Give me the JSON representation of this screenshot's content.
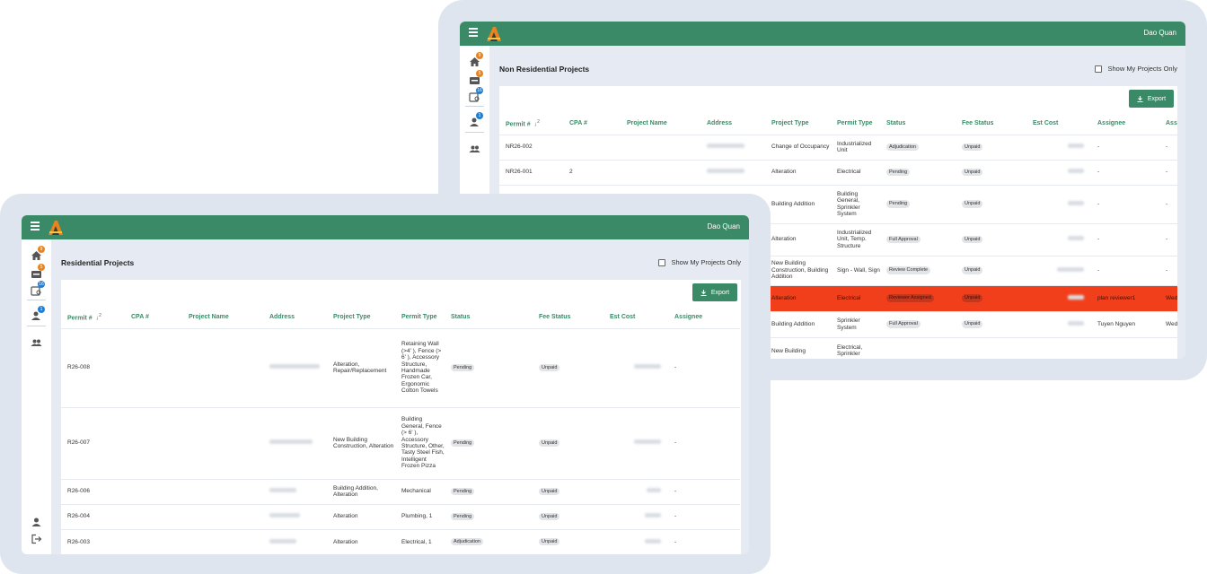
{
  "back": {
    "user": "Dao Quan",
    "rail_badges": [
      "9",
      "5",
      "16",
      "1"
    ],
    "title": "Non Residential Projects",
    "show_my": "Show My Projects Only",
    "export": "Export",
    "sort_priority": "2",
    "headers": [
      "Permit #",
      "CPA #",
      "Project Name",
      "Address",
      "Project Type",
      "Permit Type",
      "Status",
      "Fee Status",
      "Est Cost",
      "Assignee",
      "Ass"
    ],
    "rows": [
      {
        "permit": "NR26-002",
        "cpa": "",
        "ptype": "Change of Occupancy",
        "permtype": "Industrialized Unit",
        "status": "Adjudication",
        "fee": "Unpaid",
        "assignee": "-",
        "extra": "-"
      },
      {
        "permit": "NR26-001",
        "cpa": "2",
        "ptype": "Alteration",
        "permtype": "Electrical",
        "status": "Pending",
        "fee": "Unpaid",
        "assignee": "-",
        "extra": "-"
      },
      {
        "permit": "",
        "cpa": "",
        "ptype": "Building Addition",
        "permtype": "Building General, Sprinkler System",
        "status": "Pending",
        "fee": "Unpaid",
        "assignee": "-",
        "extra": "-"
      },
      {
        "permit": "",
        "cpa": "",
        "ptype": "Alteration",
        "permtype": "Industrialized Unit, Temp. Structure",
        "status": "Full Approval",
        "fee": "Unpaid",
        "assignee": "-",
        "extra": "-"
      },
      {
        "permit": "",
        "cpa": "",
        "ptype": "New Building Construction, Building Addition",
        "permtype": "Sign - Wall, Sign",
        "status": "Review Complete",
        "fee": "Unpaid",
        "assignee": "-",
        "extra": "-"
      },
      {
        "permit": "",
        "cpa": "",
        "ptype": "Alteration",
        "permtype": "Electrical",
        "status": "Reviewer Assigned",
        "fee": "Unpaid",
        "assignee": "plan reviewer1",
        "extra": "Wed 16:2"
      },
      {
        "permit": "",
        "cpa": "",
        "ptype": "Building Addition",
        "permtype": "Sprinkler System",
        "status": "Full Approval",
        "fee": "Unpaid",
        "assignee": "Tuyen Nguyen",
        "extra": "Wed 07:1"
      },
      {
        "permit": "",
        "cpa": "",
        "ptype": "New Building",
        "permtype": "Electrical, Sprinkler",
        "status": "",
        "fee": "",
        "assignee": "",
        "extra": ""
      }
    ]
  },
  "front": {
    "user": "Dao Quan",
    "rail_badges": [
      "9",
      "5",
      "16",
      "1"
    ],
    "title": "Residential Projects",
    "show_my": "Show My Projects Only",
    "export": "Export",
    "sort_priority": "2",
    "headers": [
      "Permit #",
      "CPA #",
      "Project Name",
      "Address",
      "Project Type",
      "Permit Type",
      "Status",
      "Fee Status",
      "Est Cost",
      "Assignee"
    ],
    "rows": [
      {
        "permit": "R26-008",
        "ptype": "Alteration, Repair/Replacement",
        "permtype": "Retaining Wall (>4' ), Fence (> 6' ), Accessory Structure, Handmade Frozen Car, Ergonomic Cotton Towels",
        "status": "Pending",
        "fee": "Unpaid",
        "assignee": "-"
      },
      {
        "permit": "R26-007",
        "ptype": "New Building Construction, Alteration",
        "permtype": "Building General, Fence (> 6' ), Accessory Structure, Other, Tasty Steel Fish, Intelligent Frozen Pizza",
        "status": "Pending",
        "fee": "Unpaid",
        "assignee": "-"
      },
      {
        "permit": "R26-006",
        "ptype": "Building Addition, Alteration",
        "permtype": "Mechanical",
        "status": "Pending",
        "fee": "Unpaid",
        "assignee": "-"
      },
      {
        "permit": "R26-004",
        "ptype": "Alteration",
        "permtype": "Plumbing, 1",
        "status": "Pending",
        "fee": "Unpaid",
        "assignee": "-"
      },
      {
        "permit": "R26-003",
        "ptype": "Alteration",
        "permtype": "Electrical, 1",
        "status": "Adjudication",
        "fee": "Unpaid",
        "assignee": "-"
      }
    ]
  }
}
